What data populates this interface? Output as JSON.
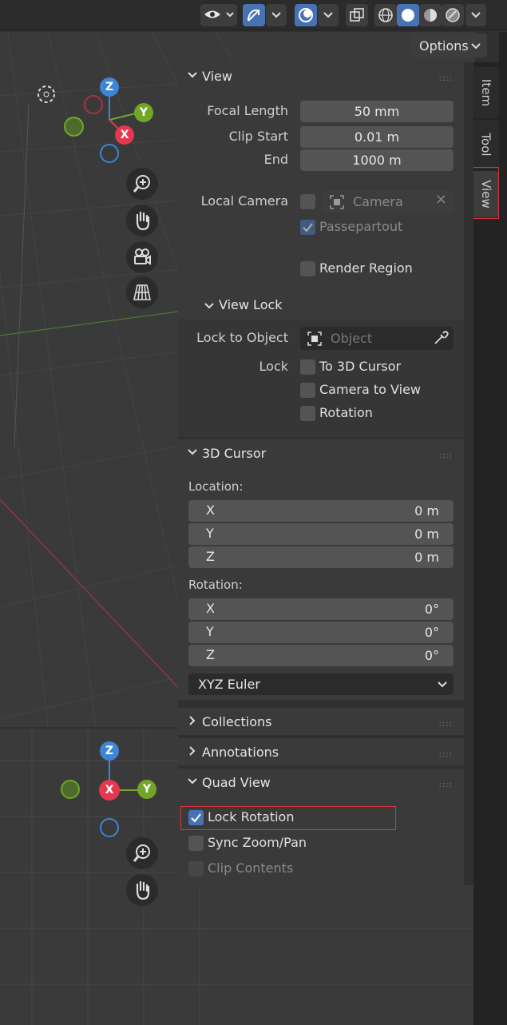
{
  "options": {
    "label": "Options"
  },
  "tabs": [
    {
      "label": "Item"
    },
    {
      "label": "Tool"
    },
    {
      "label": "View"
    }
  ],
  "gizmo": {
    "z": "Z",
    "y": "Y",
    "x": "X"
  },
  "view_panel": {
    "title": "View",
    "focal_length_label": "Focal Length",
    "focal_length_value": "50 mm",
    "clip_start_label": "Clip Start",
    "clip_start_value": "0.01 m",
    "end_label": "End",
    "end_value": "1000 m",
    "local_camera_label": "Local Camera",
    "camera_placeholder": "Camera",
    "passepartout_label": "Passepartout",
    "render_region_label": "Render Region",
    "view_lock": {
      "title": "View Lock",
      "lock_to_object_label": "Lock to Object",
      "object_placeholder": "Object",
      "lock_label": "Lock",
      "to_3d_cursor": "To 3D Cursor",
      "camera_to_view": "Camera to View",
      "rotation": "Rotation"
    }
  },
  "cursor_panel": {
    "title": "3D Cursor",
    "location_label": "Location:",
    "location": [
      {
        "axis": "X",
        "value": "0 m"
      },
      {
        "axis": "Y",
        "value": "0 m"
      },
      {
        "axis": "Z",
        "value": "0 m"
      }
    ],
    "rotation_label": "Rotation:",
    "rotation": [
      {
        "axis": "X",
        "value": "0°"
      },
      {
        "axis": "Y",
        "value": "0°"
      },
      {
        "axis": "Z",
        "value": "0°"
      }
    ],
    "rotation_mode": "XYZ Euler"
  },
  "collections_panel": {
    "title": "Collections"
  },
  "annotations_panel": {
    "title": "Annotations"
  },
  "quad_view_panel": {
    "title": "Quad View",
    "lock_rotation": "Lock Rotation",
    "sync_zoom_pan": "Sync Zoom/Pan",
    "clip_contents": "Clip Contents"
  },
  "colors": {
    "accent": "#4772b3",
    "axis_x": "#e5374f",
    "axis_y": "#71a628",
    "axis_z": "#3d85d6",
    "highlight": "#d9363e"
  }
}
